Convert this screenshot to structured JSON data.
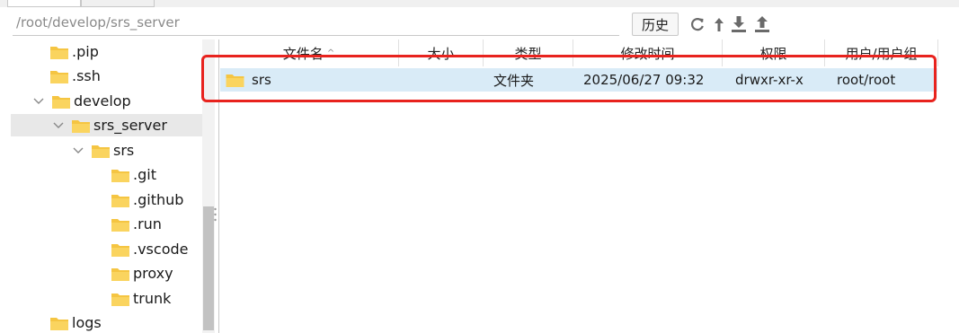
{
  "path_bar": {
    "path": "/root/develop/srs_server",
    "history_label": "历史"
  },
  "toolbar": {
    "icons": [
      "refresh-icon",
      "up-arrow-icon",
      "download-icon",
      "upload-icon"
    ]
  },
  "tree": {
    "items": [
      {
        "label": ".pip",
        "depth": 1,
        "expanded": false,
        "selected": false
      },
      {
        "label": ".ssh",
        "depth": 1,
        "expanded": false,
        "selected": false
      },
      {
        "label": "develop",
        "depth": 1,
        "expanded": true,
        "selected": false
      },
      {
        "label": "srs_server",
        "depth": 2,
        "expanded": true,
        "selected": true
      },
      {
        "label": "srs",
        "depth": 3,
        "expanded": true,
        "selected": false
      },
      {
        "label": ".git",
        "depth": 4,
        "expanded": false,
        "selected": false
      },
      {
        "label": ".github",
        "depth": 4,
        "expanded": false,
        "selected": false
      },
      {
        "label": ".run",
        "depth": 4,
        "expanded": false,
        "selected": false
      },
      {
        "label": ".vscode",
        "depth": 4,
        "expanded": false,
        "selected": false
      },
      {
        "label": "proxy",
        "depth": 4,
        "expanded": false,
        "selected": false
      },
      {
        "label": "trunk",
        "depth": 4,
        "expanded": false,
        "selected": false
      },
      {
        "label": "logs",
        "depth": 1,
        "expanded": false,
        "selected": false
      }
    ]
  },
  "file_list": {
    "columns": {
      "name": "文件名",
      "size": "大小",
      "type": "类型",
      "modified": "修改时间",
      "permissions": "权限",
      "owner": "用户/用户组"
    },
    "sort_indicator": "^",
    "rows": [
      {
        "name": "srs",
        "size": "",
        "type": "文件夹",
        "modified": "2025/06/27 09:32",
        "permissions": "drwxr-xr-x",
        "owner": "root/root"
      }
    ]
  },
  "colors": {
    "folder": "#f5c542",
    "selected_row": "#d9ebf7",
    "highlight_box": "#e8231e",
    "tree_selected": "#e8e8e8"
  }
}
